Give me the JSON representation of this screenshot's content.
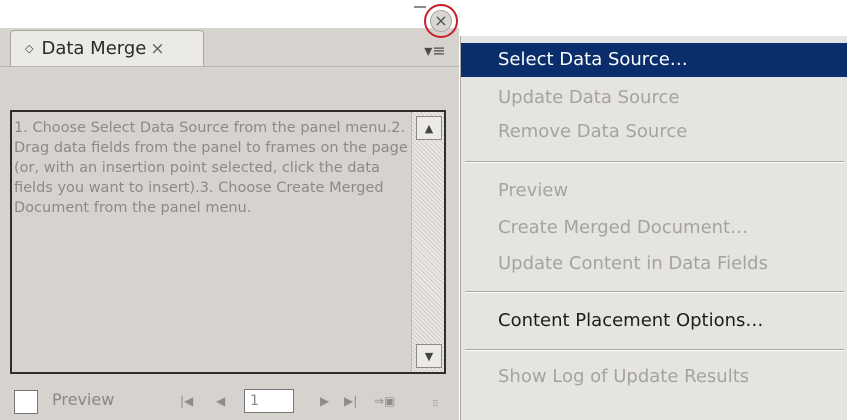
{
  "panel": {
    "tab_label": "Data Merge",
    "tab_diamond": "◇",
    "tab_close": "×",
    "close_glyph": "×",
    "menu_glyph": "▾≡",
    "instructions": "1. Choose Select Data Source from the panel menu.2. Drag data fields from the panel to frames on the page (or, with an insertion point selected, click the data fields you want to insert).3. Choose Create Merged Document from the panel menu.",
    "scroll_up_glyph": "▲",
    "scroll_down_glyph": "▼",
    "footer": {
      "preview_label": "Preview",
      "first_glyph": "|◀",
      "prev_glyph": "◀",
      "page_number": "1",
      "next_glyph": "▶",
      "last_glyph": "▶|",
      "goto_glyph": "⇒▣",
      "grip_glyph": "⠿"
    }
  },
  "menu": {
    "items": [
      {
        "label": "Select Data Source…",
        "state": "selected"
      },
      {
        "label": "Update Data Source",
        "state": "disabled"
      },
      {
        "label": "Remove Data Source",
        "state": "disabled"
      },
      {
        "label": "Preview",
        "state": "disabled"
      },
      {
        "label": "Create Merged Document…",
        "state": "disabled"
      },
      {
        "label": "Update Content in Data Fields",
        "state": "disabled"
      },
      {
        "label": "Content Placement Options…",
        "state": "enabled"
      },
      {
        "label": "Show Log of Update Results",
        "state": "disabled"
      }
    ]
  },
  "colors": {
    "panel_bg": "#d6d3ce",
    "menu_bg": "#e6e4e0",
    "selection": "#0a2e6c",
    "highlight_ring": "#c8202a",
    "disabled_text": "#a5a39e"
  }
}
